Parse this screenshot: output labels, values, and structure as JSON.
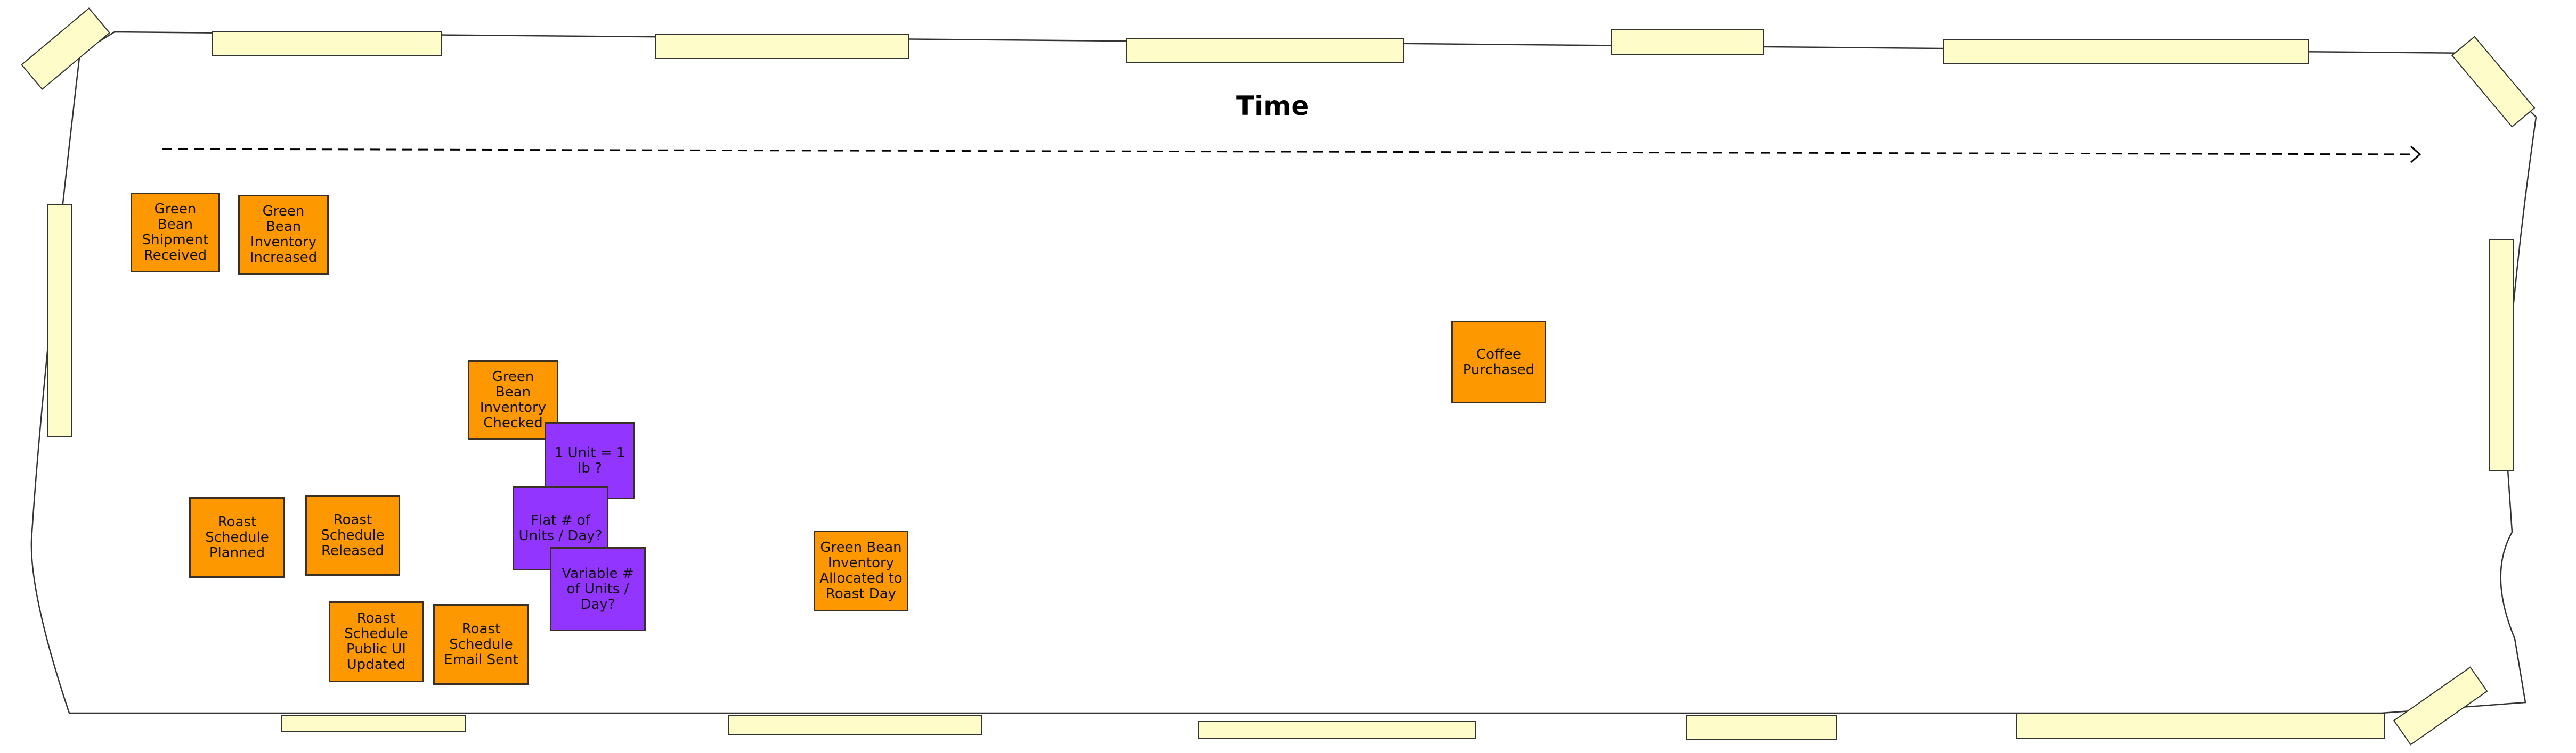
{
  "board": {
    "title": "Time",
    "arrow": "timeline-arrow",
    "colors": {
      "event": "#fd9800",
      "question": "#9135ff",
      "tape": "#fefcc8",
      "stroke": "#3a3026"
    }
  },
  "stickies": [
    {
      "id": "green-bean-shipment-received",
      "text": "Green Bean Shipment Received",
      "kind": "event"
    },
    {
      "id": "green-bean-inventory-increased",
      "text": "Green Bean Inventory Increased",
      "kind": "event"
    },
    {
      "id": "green-bean-inventory-checked",
      "text": "Green Bean Inventory Checked",
      "kind": "event"
    },
    {
      "id": "one-unit-question",
      "text": "1 Unit = 1 lb ?",
      "kind": "question"
    },
    {
      "id": "flat-units-question",
      "text": "Flat # of Units / Day?",
      "kind": "question"
    },
    {
      "id": "variable-units-question",
      "text": "Variable # of Units / Day?",
      "kind": "question"
    },
    {
      "id": "roast-schedule-planned",
      "text": "Roast Schedule Planned",
      "kind": "event"
    },
    {
      "id": "roast-schedule-released",
      "text": "Roast Schedule Released",
      "kind": "event"
    },
    {
      "id": "roast-schedule-public-ui-updated",
      "text": "Roast Schedule Public UI Updated",
      "kind": "event"
    },
    {
      "id": "roast-schedule-email-sent",
      "text": "Roast Schedule Email Sent",
      "kind": "event"
    },
    {
      "id": "green-bean-inventory-allocated",
      "text": "Green Bean Inventory Allocated to Roast Day",
      "kind": "event"
    },
    {
      "id": "coffee-purchased",
      "text": "Coffee Purchased",
      "kind": "event"
    }
  ]
}
